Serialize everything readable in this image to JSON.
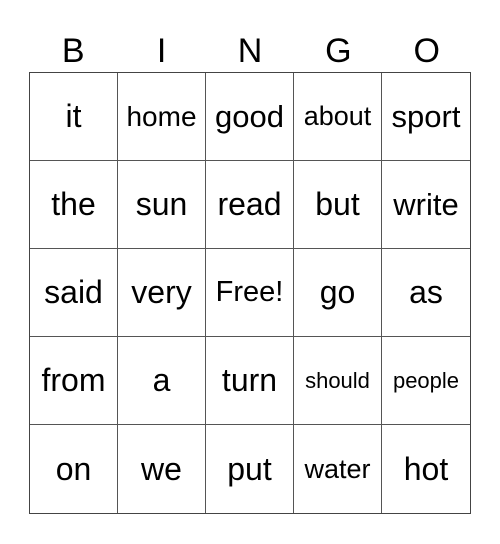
{
  "header": [
    "B",
    "I",
    "N",
    "G",
    "O"
  ],
  "cells": [
    [
      "it",
      "home",
      "good",
      "about",
      "sport"
    ],
    [
      "the",
      "sun",
      "read",
      "but",
      "write"
    ],
    [
      "said",
      "very",
      "Free!",
      "go",
      "as"
    ],
    [
      "from",
      "a",
      "turn",
      "should",
      "people"
    ],
    [
      "on",
      "we",
      "put",
      "water",
      "hot"
    ]
  ]
}
